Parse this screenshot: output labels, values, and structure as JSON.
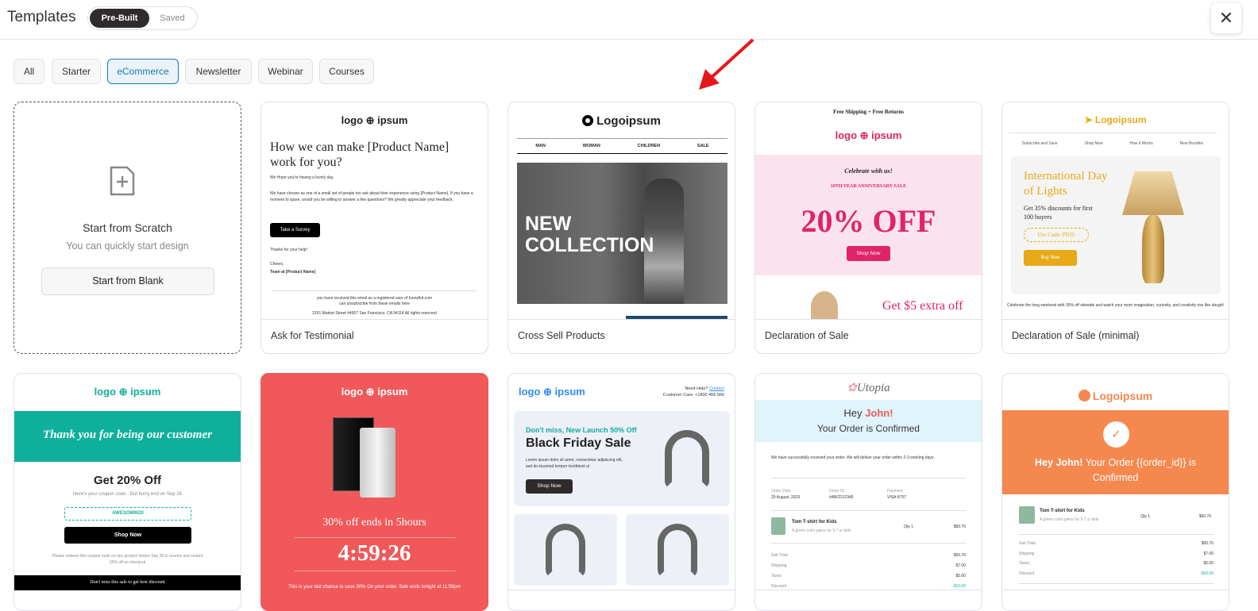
{
  "header": {
    "title": "Templates",
    "tabs": [
      "Pre-Built",
      "Saved"
    ],
    "close_icon": "close-icon"
  },
  "filters": [
    "All",
    "Starter",
    "eCommerce",
    "Newsletter",
    "Webinar",
    "Courses"
  ],
  "active_filter": "eCommerce",
  "scratch": {
    "title": "Start from Scratch",
    "subtitle": "You can quickly start design",
    "button": "Start from Blank"
  },
  "templates": [
    {
      "name": "Ask for Testimonial",
      "logo": "logo ⊕ ipsum",
      "heading": "How we can make [Product Name] work for you?",
      "p1": "We Hope you're having a lovely day.",
      "p2": "We have chosen as one of a small set of people too ask about their experience using [Product Name]. If you have a moment to spare, would you be willing to answer a few questions? We greatly appreciate your feedback.",
      "button": "Take a Survey",
      "thanks": "Thanks for your help!",
      "cheers": "Cheers,",
      "team": "Team at [Product Name]",
      "footer1": "you have received this email as a registered user of funnelkit.com",
      "footer2": "can unsubscribe from these emails here",
      "address": "2261 Market Street #4667 San Francisco, CA 94114 All rights reserved"
    },
    {
      "name": "Cross Sell Products",
      "logo": "Logoipsum",
      "nav": [
        "MAN",
        "WOMAN",
        "CHILDREN",
        "SALE"
      ],
      "hero": "NEW COLLECTION"
    },
    {
      "name": "Declaration of Sale",
      "topbar": "Free Shipping  +  Free Returns",
      "logo": "logo ⊕ ipsum",
      "celebrate": "Celebrate with us!",
      "anniv": "10TH YEAR ANNIVERSARY SALE",
      "offer": "20% OFF",
      "button": "Shop Now",
      "extra": "Get $5 extra off"
    },
    {
      "name": "Declaration of Sale (minimal)",
      "logo": "Logoipsum",
      "nav": [
        "Subscribe and Save",
        "Shop Now",
        "How it Works",
        "New Bundles"
      ],
      "heading": "International Day of Lights",
      "sub": "Get 35% discounts for first 100 buyers",
      "code": "Use Code: PD35",
      "button": "Buy Now",
      "body": "Celebrate the long weekend with 35% off sitewide and watch your mom imagination, curiosity, and creativity rise like dough!"
    },
    {
      "name": "",
      "logo": "logo ⊕ ipsum",
      "banner": "Thank you for being our customer",
      "heading": "Get 20% Off",
      "sub": "Here's your coupon code - But hurry end on  Sep 28",
      "code": "AWESOMW20",
      "button": "Shop Now",
      "note": "Please redeem this coupon code on any product before Sep 28 to receive and instant 20% off on checkout",
      "bar": "Don't miss this sale to get best discount"
    },
    {
      "name": "",
      "logo": "logo ⊕ ipsum",
      "offer": "30% off ends in 5hours",
      "timer": "4:59:26",
      "note": "This is your last chance to save 30% On your order. Sale ends tonight at 11:59pm"
    },
    {
      "name": "",
      "logo": "logo ⊕ ipsum",
      "help": "Need Help?",
      "contact": "Contact",
      "care": "Customer Care: +1800 456 566",
      "kicker": "Don't miss, New Launch 50% Off",
      "heading": "Black Friday Sale",
      "body": "Lorem ipsum dolor sit amet, consectetur adipiscing elit, sed do eiusmod tempor incididunt ut",
      "button": "Shop Now"
    },
    {
      "name": "",
      "logo": "Utopia",
      "hey": "Hey",
      "john": "John!",
      "confirmed": "Your Order is Confirmed",
      "intro": "We have successfully received your order. We will deliver your order within 2-3 working days.",
      "meta": [
        {
          "k": "Order Date",
          "v": "29 August, 2023"
        },
        {
          "k": "Order ID",
          "v": "#ABCD12345"
        },
        {
          "k": "Payment",
          "v": "VISA-8757"
        }
      ],
      "item": "Tom T-shirt for Kids",
      "item_desc": "A green color piece for 3-7 yr kids",
      "qty": "Qty 1",
      "price": "$50.76",
      "totals": [
        {
          "k": "Sub Total",
          "v": "$50.76"
        },
        {
          "k": "Shipping",
          "v": "$7.00"
        },
        {
          "k": "Taxes",
          "v": "$5.00"
        },
        {
          "k": "Discount",
          "v": "-$10.00"
        }
      ]
    },
    {
      "name": "",
      "logo": "Logoipsum",
      "hey": "Hey John!",
      "msg": "Your Order {{order_id}} is Confirmed",
      "item": "Tom T-shirt for Kids",
      "item_desc": "A green color piece for 3-7 yr kids",
      "qty": "Qty 1",
      "price": "$50.76",
      "totals": [
        {
          "k": "Sub Total",
          "v": "$50.76"
        },
        {
          "k": "Shipping",
          "v": "$7.00"
        },
        {
          "k": "Taxes",
          "v": "$5.00"
        },
        {
          "k": "Discount",
          "v": "-$10.00"
        }
      ]
    }
  ],
  "colors": {
    "accent": "#1b7cb5",
    "dark": "#2f2b2b",
    "arrow": "#e8161b",
    "teal": "#0fb09b",
    "coral": "#f0585a",
    "pink": "#e0246a",
    "orange": "#f5884f",
    "gold": "#e8a917"
  }
}
